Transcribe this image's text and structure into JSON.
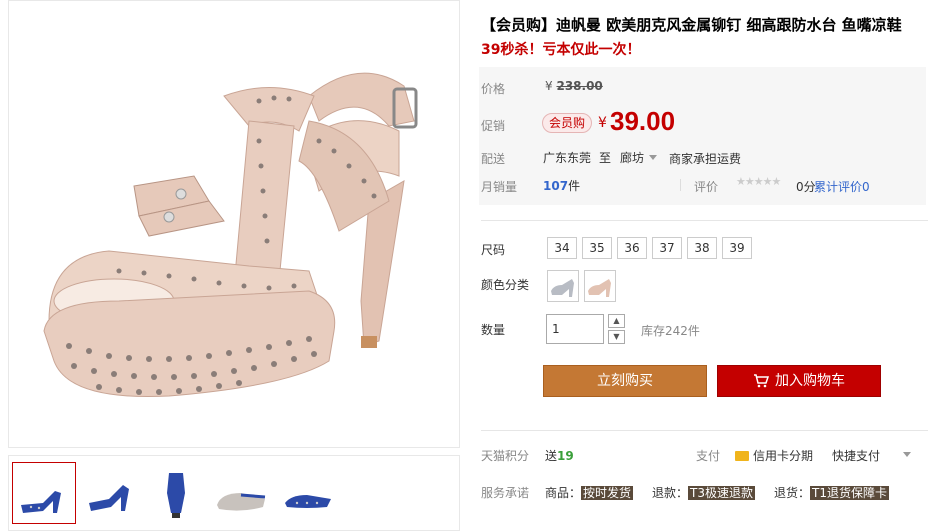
{
  "product": {
    "title": "【会员购】迪帆曼 欧美朋克风金属铆钉 细高跟防水台 鱼嘴凉鞋",
    "subtitle": "39秒杀！亏本仅此一次！"
  },
  "price": {
    "label": "价格",
    "currency": "¥",
    "original": "238.00",
    "promo_label": "促销",
    "promo_badge": "会员购",
    "promo_price": "39.00"
  },
  "shipping": {
    "label": "配送",
    "from": "广东东莞",
    "to_word": "至",
    "destination": "廊坊",
    "fee_text": "商家承担运费"
  },
  "sales": {
    "label": "月销量",
    "count": "107",
    "unit": "件",
    "review_label": "评价",
    "stars": "★★★★★",
    "rating": "0分",
    "review_link": "累计评价0"
  },
  "size": {
    "label": "尺码",
    "options": [
      "34",
      "35",
      "36",
      "37",
      "38",
      "39"
    ]
  },
  "color": {
    "label": "颜色分类",
    "options": [
      "silver-sandal",
      "nude-sandal"
    ]
  },
  "quantity": {
    "label": "数量",
    "value": "1",
    "stock": "库存242件"
  },
  "actions": {
    "buy_now": "立刻购买",
    "add_to_cart": "加入购物车"
  },
  "extras": {
    "points_label": "天猫积分",
    "points_prefix": "送",
    "points_value": "19",
    "pay_label": "支付",
    "pay_credit": "信用卡分期",
    "pay_quick": "快捷支付",
    "service_label": "服务承诺",
    "services": [
      {
        "prefix": "商品：",
        "tag": "按时发货"
      },
      {
        "prefix": "退款：",
        "tag": "T3极速退款"
      },
      {
        "prefix": "退货：",
        "tag": "T1退货保障卡"
      }
    ]
  },
  "colors": {
    "accent_red": "#c40000",
    "buy_orange": "#c47834",
    "link_blue": "#3366cc",
    "points_green": "#3a9f3a",
    "shoe_nude": "#e8cdbf",
    "shoe_blue": "#2c4aa8"
  }
}
